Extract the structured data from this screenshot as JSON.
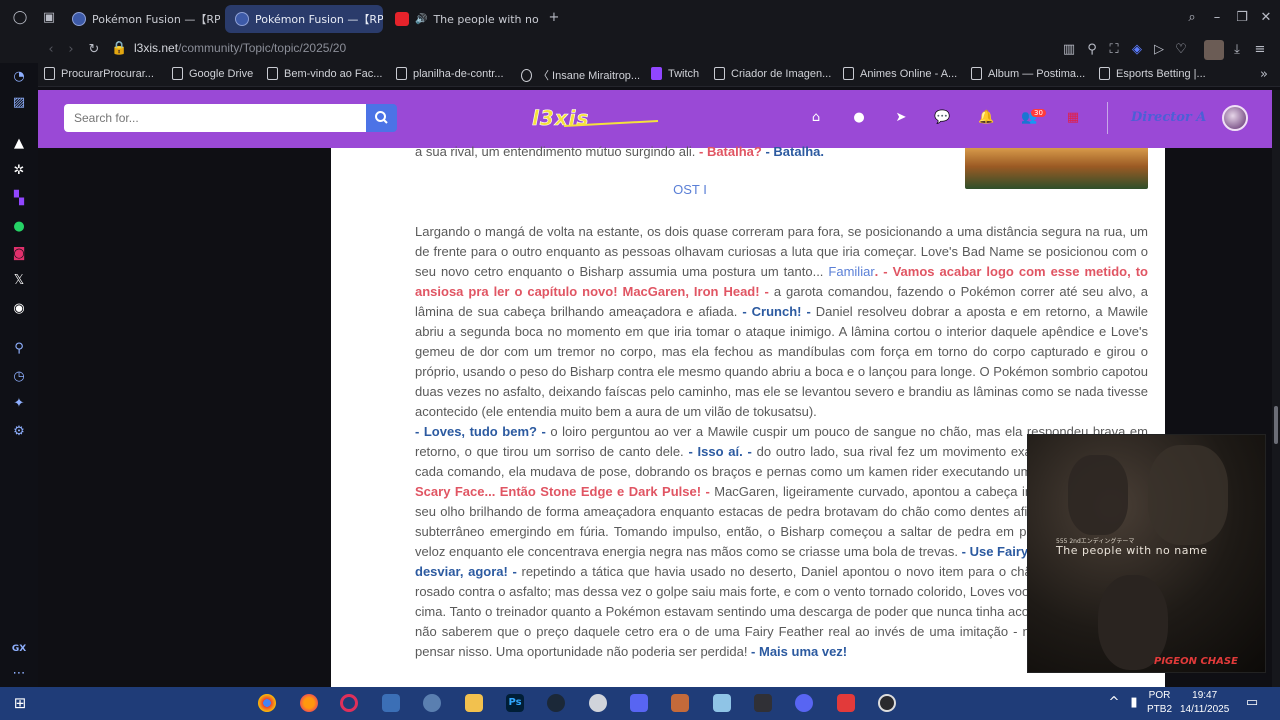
{
  "browser": {
    "tabs": [
      {
        "title": "Pokémon Fusion —【RPG】",
        "active": false
      },
      {
        "title": "Pokémon Fusion —【RPG】",
        "active": true
      },
      {
        "title": "The people with no na",
        "active": false
      }
    ],
    "url_host": "l3xis.net",
    "url_path": "/community/Topic/topic/2025/20",
    "bookmarks": [
      "ProcurarProcurar...",
      "Google Drive",
      "Bem-vindo ao Fac...",
      "planilha-de-contr...",
      "〈 Insane Miraitrop...",
      "Twitch",
      "Criador de Imagen...",
      "Animes Online - A...",
      "Album — Postima...",
      "Esports Betting |..."
    ]
  },
  "site": {
    "search_placeholder": "Search for...",
    "logo_text": "l3xis",
    "notification_count": "30",
    "username": "Director A"
  },
  "content": {
    "top_line_prefix": "a sua rival, um entendimento mútuo surgindo ali. ",
    "top_line_red": "- Batalha? ",
    "top_line_blue": "- Batalha.",
    "ost": "OST I",
    "p1_a": "Largando o mangá de volta na estante, os dois quase correram para fora, se posicionando a uma distância segura na rua, um de frente para o outro enquanto as pessoas olhavam curiosas a luta que iria começar. Love's Bad Name se posicionou com o seu novo cetro enquanto o Bisharp assumia uma postura um tanto... ",
    "p1_link": "Familiar",
    "p1_red": ". - Vamos acabar logo com esse metido, to ansiosa pra ler o capítulo novo! MacGaren, Iron Head! -",
    "p1_b": " a garota comandou, fazendo o Pokémon correr até seu alvo, a lâmina de sua cabeça brilhando ameaçadora e afiada. ",
    "p1_blue": "- Crunch! -",
    "p1_c": " Daniel resolveu dobrar a aposta e em retorno, a Mawile abriu a segunda boca no momento em que iria tomar o ataque inimigo. A lâmina cortou o interior daquele apêndice e Love's gemeu de dor com um tremor no corpo, mas ela fechou as mandíbulas com força em torno do corpo capturado e girou o próprio, usando o peso do Bisharp contra ele mesmo quando abriu a boca e o lançou para longe. O Pokémon sombrio capotou duas vezes no asfalto, deixando faíscas pelo caminho, mas ele se levantou severo e brandiu as lâminas como se nada tivesse acontecido (ele entendia muito bem a aura de um vilão de tokusatsu).",
    "p2_blue": "- Loves, tudo bem? -",
    "p2_a": " o loiro perguntou ao ver a Mawile cuspir um pouco de sangue no chão, mas ela respondeu brava em retorno, o que tirou um sorriso de canto dele. ",
    "p2_blue2": "- Isso aí. -",
    "p2_b": " do outro lado, sua rival fez um movimento exagerado para eles. A cada comando, ela mudava de pose, dobrando os braços e pernas como um kamen rider executando uma técnica especial. ",
    "p2_red": "- Scary Face... Então Stone Edge e Dark Pulse! -",
    "p2_c": " MacGaren, ligeiramente curvado, apontou a cabeça inclinado para o lado, seu olho brilhando de forma ameaçadora enquanto estacas de pedra brotavam do chão como dentes afiados de um monstro subterrâneo emergindo em fúria. Tomando impulso, então, o Bisharp começou a saltar de pedra em pedra, cada vez mais veloz enquanto ele concentrava energia negra nas mãos como se criasse uma bola de trevas. ",
    "p2_blue3": "- Use Fairy Wind no chão para desviar, agora! -",
    "p2_d": " repetindo a tática que havia usado no deserto, Daniel apontou o novo item para o chão e gerou um vento rosado contra o asfalto; mas dessa vez o golpe saiu mais forte, e com o vento tornado colorido, Loves voou vários metros para cima. Tanto o treinador quanto a Pokémon estavam sentindo uma descarga de poder que nunca tinha acontecido antes - e por não saberem que o preço daquele cetro era o de uma Fairy Feather real ao invés de uma imitação - mas não era hora de pensar nisso. Uma oportunidade não poderia ser perdida! ",
    "p2_blue4": "- Mais uma vez!"
  },
  "video_pip": {
    "title": "The people with no name",
    "jp_caption": "555 2ndエンディングテーマ",
    "label": "PIGEON CHASE"
  },
  "taskbar": {
    "lang": "POR",
    "lang2": "PTB2",
    "time": "19:47",
    "date": "14/11/2025"
  }
}
